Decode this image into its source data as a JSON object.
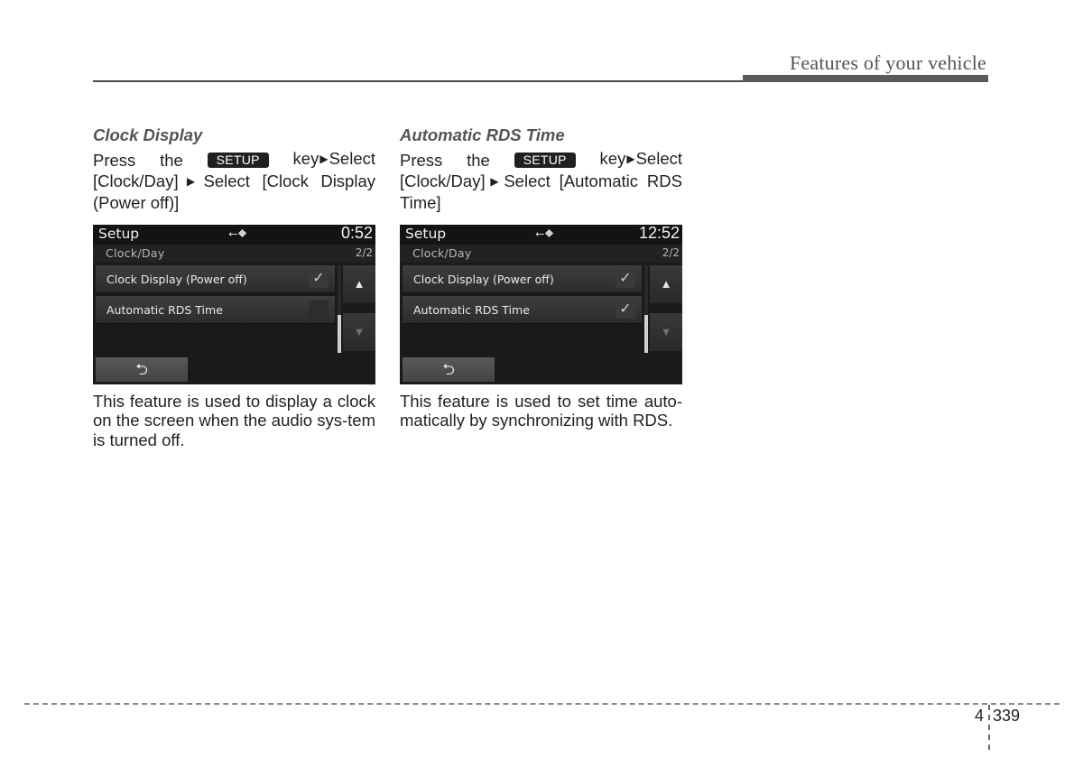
{
  "header": {
    "title": "Features of your vehicle"
  },
  "sections": [
    {
      "title": "Clock Display",
      "instr_press": "Press",
      "instr_the": "the",
      "key_label": "SETUP",
      "instr_key": "key",
      "instr_select1": "Select",
      "instr_line2_a": "[Clock/Day]",
      "instr_line2_b": "Select [Clock Display (Power off)]",
      "arrow": "▶",
      "screen": {
        "title": "Setup",
        "usb_icon": "usb-icon",
        "time": "0:52",
        "breadcrumb": "Clock/Day",
        "page": "2/2",
        "items": [
          {
            "label": "Clock Display (Power off)",
            "checked": true,
            "check_glyph": "✓"
          },
          {
            "label": "Automatic RDS Time",
            "checked": false,
            "check_glyph": ""
          }
        ],
        "up_glyph": "▲",
        "down_glyph": "▼",
        "back_glyph": "⮌"
      },
      "description": "This feature is used to display a clock on the screen when the audio sys-tem is turned off."
    },
    {
      "title": "Automatic RDS Time",
      "instr_press": "Press",
      "instr_the": "the",
      "key_label": "SETUP",
      "instr_key": "key",
      "instr_select1": "Select",
      "instr_line2_a": "[Clock/Day]",
      "instr_line2_b": "Select [Automatic RDS Time]",
      "arrow": "▶",
      "screen": {
        "title": "Setup",
        "usb_icon": "usb-icon",
        "time": "12:52",
        "breadcrumb": "Clock/Day",
        "page": "2/2",
        "items": [
          {
            "label": "Clock Display (Power off)",
            "checked": true,
            "check_glyph": "✓"
          },
          {
            "label": "Automatic RDS Time",
            "checked": true,
            "check_glyph": "✓"
          }
        ],
        "up_glyph": "▲",
        "down_glyph": "▼",
        "back_glyph": "⮌"
      },
      "description": "This feature is used to set time auto-matically by synchronizing with RDS."
    }
  ],
  "footer": {
    "chapter": "4",
    "page": "339"
  }
}
